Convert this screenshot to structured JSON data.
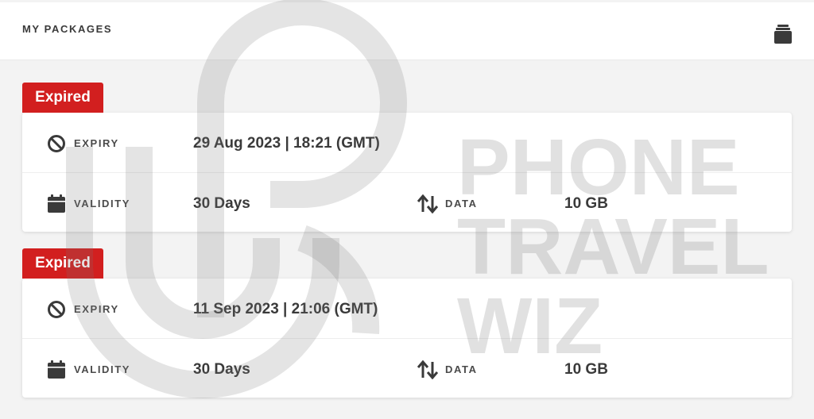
{
  "header": {
    "title": "MY PACKAGES",
    "icon": "package-icon"
  },
  "packages": [
    {
      "status": "Expired",
      "expiry_label": "EXPIRY",
      "expiry_value": "29 Aug 2023 | 18:21 (GMT)",
      "validity_label": "VALIDITY",
      "validity_value": "30 Days",
      "data_label": "DATA",
      "data_value": "10 GB"
    },
    {
      "status": "Expired",
      "expiry_label": "EXPIRY",
      "expiry_value": "11 Sep 2023 | 21:06 (GMT)",
      "validity_label": "VALIDITY",
      "validity_value": "30 Days",
      "data_label": "DATA",
      "data_value": "10 GB"
    }
  ],
  "watermark": {
    "lines": [
      "PHONE",
      "TRAVEL",
      "WIZ"
    ]
  },
  "colors": {
    "badge": "#d21f1f",
    "background": "#f3f3f3",
    "card": "#ffffff"
  }
}
